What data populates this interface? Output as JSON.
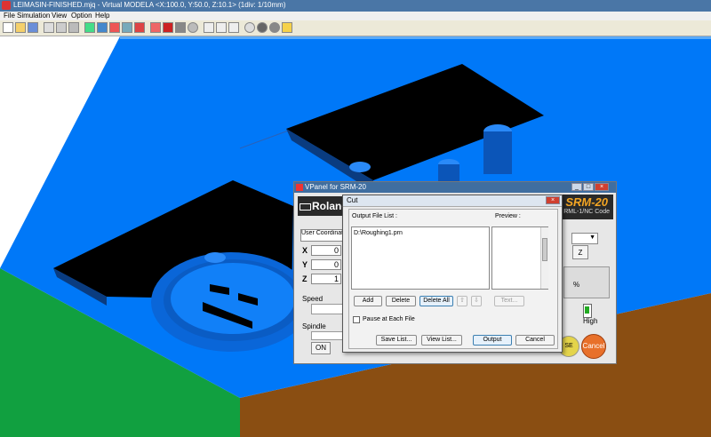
{
  "window": {
    "title": "LEIMASIN-FINISHED.mjq - Virtual MODELA <X:100.0, Y:50.0, Z:10.1> (1div: 1/10mm)"
  },
  "menu": [
    "File",
    "Simulation",
    "View",
    "Option",
    "Help"
  ],
  "toolbar": {
    "icons": [
      "new-icon",
      "open-icon",
      "save-icon",
      "print-icon",
      "undo-icon",
      "cut-icon",
      "copy-icon",
      "paste-icon",
      "view-icon",
      "tool-icon",
      "select-icon",
      "rotate-icon",
      "zoom-icon",
      "fit-icon",
      "shade-icon",
      "wire-icon",
      "path-icon",
      "play-icon",
      "stop-icon",
      "measure-icon",
      "light-icon",
      "star-icon"
    ]
  },
  "colors": {
    "model_top": "#0078f8",
    "model_side_green": "#11a040",
    "model_side_brown": "#8a4e12",
    "pocket": "#000000",
    "titlebar": "#4a76a6"
  },
  "vpanel": {
    "title": "VPanel for SRM-20",
    "brand": "Roland",
    "model_title": "SRM-20",
    "model_sub": "RML-1/NC Code",
    "coord_system": "User Coordinate S",
    "axes": [
      {
        "label": "X",
        "value": "0"
      },
      {
        "label": "Y",
        "value": "0"
      },
      {
        "label": "Z",
        "value": "1"
      }
    ],
    "speed_label": "Speed",
    "spindle_label": "Spindle",
    "on_label": "ON",
    "z_button": "Z",
    "percent_label": "%",
    "high_label": "High",
    "pause_label": "SE",
    "cancel_label": "Cancel"
  },
  "cut": {
    "title": "Cut",
    "output_file_list_label": "Output File List :",
    "preview_label": "Preview :",
    "files": [
      "D:\\Roughing1.prn"
    ],
    "buttons": {
      "add": "Add",
      "delete": "Delete",
      "delete_all": "Delete All",
      "text": "Text...",
      "up": "⇧",
      "down": "⇩"
    },
    "pause_at_each_file": "Pause at Each File",
    "bottom": {
      "save_list": "Save List...",
      "view_list": "View List...",
      "output": "Output",
      "cancel": "Cancel"
    }
  }
}
